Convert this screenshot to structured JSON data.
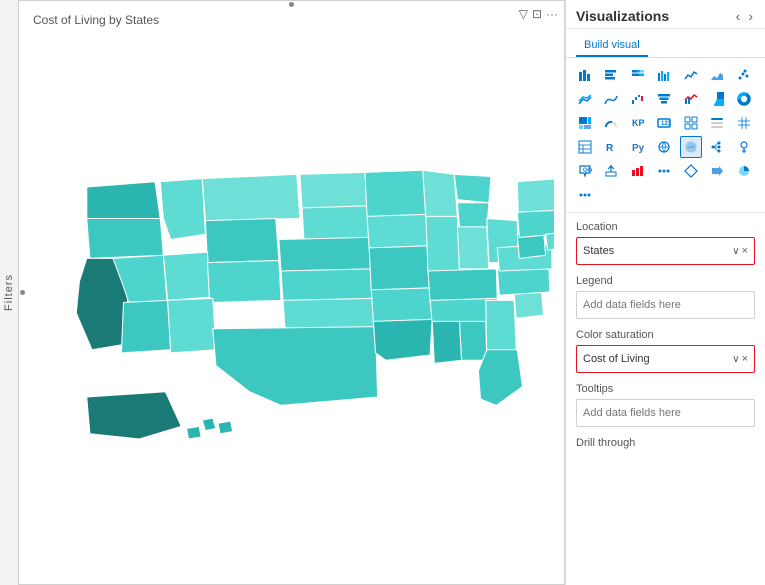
{
  "filters_label": "Filters",
  "chart": {
    "title": "Cost of Living by States",
    "toolbar": {
      "filter_icon": "▽",
      "resize_icon": "⊡",
      "more_icon": "···"
    }
  },
  "viz_panel": {
    "title": "Visualizations",
    "nav": {
      "back": "‹",
      "forward": "›"
    },
    "tabs": [
      {
        "id": "build",
        "label": "Build visual",
        "active": true
      }
    ],
    "icon_rows": [
      [
        "bar-chart-icon",
        "stacked-bar-icon",
        "100pct-bar-icon",
        "clustered-bar-icon",
        "line-icon",
        "area-icon",
        "scatter-icon"
      ],
      [
        "line-area-icon",
        "mountain-icon",
        "ribbon-icon",
        "funnel-icon",
        "waterfall-icon",
        "combo-icon",
        "pie-icon"
      ],
      [
        "donut-icon",
        "treemap-icon",
        "radial-icon",
        "gauge-icon",
        "kpi-icon",
        "card-icon",
        "multirow-icon"
      ],
      [
        "slicer-icon",
        "matrix-icon",
        "table-icon",
        "r-icon",
        "py-icon",
        "map-icon",
        "filled-map-icon"
      ],
      [
        "decomp-icon",
        "key-influencer-icon",
        "qa-icon",
        "export-icon",
        "bar2-icon",
        "more-viz-icon",
        "x"
      ],
      [
        "diamond-icon",
        "arrow-icon",
        "pie2-icon",
        "ellipsis-icon",
        "",
        "",
        ""
      ]
    ],
    "selected_icon_index": "map-filled",
    "sections": [
      {
        "id": "location",
        "label": "Location",
        "field": {
          "value": "States",
          "has_value": true,
          "highlighted": true,
          "chevron": "∨",
          "close": "×"
        }
      },
      {
        "id": "legend",
        "label": "Legend",
        "field": {
          "value": "Add data fields here",
          "has_value": false,
          "highlighted": false
        }
      },
      {
        "id": "color_saturation",
        "label": "Color saturation",
        "field": {
          "value": "Cost of Living",
          "has_value": true,
          "highlighted": true,
          "chevron": "∨",
          "close": "×"
        }
      },
      {
        "id": "tooltips",
        "label": "Tooltips",
        "field": {
          "value": "Add data fields here",
          "has_value": false,
          "highlighted": false
        }
      },
      {
        "id": "drill_through",
        "label": "Drill through",
        "field": null
      }
    ]
  }
}
